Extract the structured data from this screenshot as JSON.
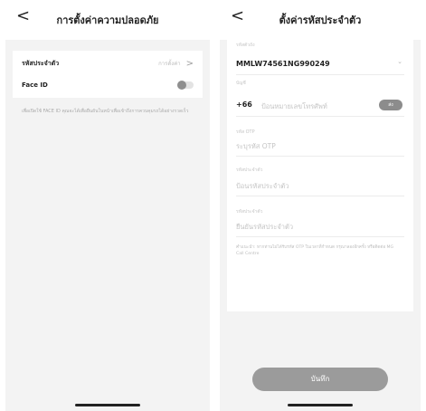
{
  "left_screen": {
    "title": "การตั้งค่าความปลอดภัย",
    "back_glyph": "<",
    "pin_row": {
      "label": "รหัสประจำตัว",
      "value": "การตั้งค่า",
      "chevron": ">"
    },
    "faceid_row": {
      "label": "Face ID",
      "toggle_state": "off"
    },
    "hint_text": "เพื่อเปิดใช้ FACE ID คุณจะได้เพื่อยืนยันในหน้าเพื่อเข้าถึงการควบคุมรถได้อย่างรวดเร็ว"
  },
  "right_screen": {
    "title": "ตั้งค่ารหัสประจำตัว",
    "back_glyph": "<",
    "vin": {
      "label": "รหัสตัวถัง",
      "value": "MMLW74561NG990249",
      "dropdown_glyph": "⌄"
    },
    "phone": {
      "label": "บัญชี",
      "country_code": "+66",
      "placeholder": "ป้อนหมายเลขโทรศัพท์",
      "otp_button": "ส่ง"
    },
    "otp": {
      "label": "รหัส OTP",
      "placeholder": "ระบุรหัส OTP"
    },
    "pin": {
      "label": "รหัสประจำตัว",
      "placeholder": "ป้อนรหัสประจำตัว"
    },
    "confirm_pin": {
      "label": "รหัสประจำตัว",
      "placeholder": "ยืนยันรหัสประจำตัว"
    },
    "note_text": "คำแนะนำ: หากท่านไม่ได้รับรหัส OTP ในเวลาที่กำหนด กรุณาลองอีกครั้ง หรือติดต่อ MG Call Centre",
    "save_button": "บันทึก"
  },
  "colors": {
    "background": "#f3f3f3",
    "card": "#ffffff",
    "button_disabled": "#9b9b9b",
    "placeholder": "#c4c4c4"
  },
  "icons": [
    "back-arrow-icon",
    "chevron-right-icon",
    "chevron-down-icon"
  ]
}
